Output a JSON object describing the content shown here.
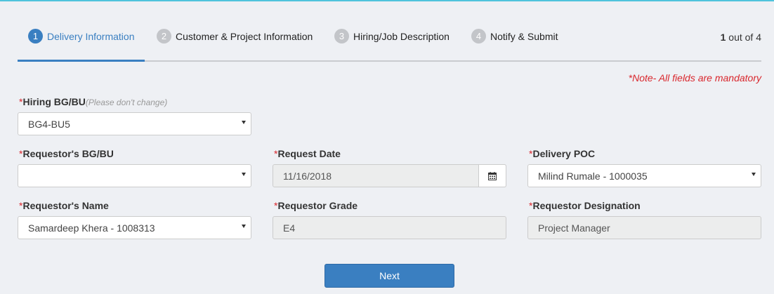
{
  "steps": [
    {
      "num": "1",
      "label": "Delivery Information",
      "active": true
    },
    {
      "num": "2",
      "label": "Customer & Project Information",
      "active": false
    },
    {
      "num": "3",
      "label": "Hiring/Job Description",
      "active": false
    },
    {
      "num": "4",
      "label": "Notify & Submit",
      "active": false
    }
  ],
  "progress": {
    "current": "1",
    "suffix": "out of 4"
  },
  "note": "*Note- All fields are mandatory",
  "required_marker": "*",
  "fields": {
    "hiring_bgbu": {
      "label": "Hiring BG/BU",
      "hint": "(Please don't change)",
      "value": "BG4-BU5"
    },
    "requestor_bgbu": {
      "label": "Requestor's BG/BU",
      "value": ""
    },
    "request_date": {
      "label": "Request Date",
      "value": "11/16/2018"
    },
    "delivery_poc": {
      "label": "Delivery POC",
      "value": "Milind Rumale - 1000035"
    },
    "requestor_name": {
      "label": "Requestor's Name",
      "value": "Samardeep Khera - 1008313"
    },
    "requestor_grade": {
      "label": "Requestor Grade",
      "value": "E4"
    },
    "requestor_designation": {
      "label": "Requestor Designation",
      "value": "Project Manager"
    }
  },
  "actions": {
    "next_label": "Next"
  },
  "icons": {
    "calendar": "calendar-icon",
    "dropdown": "caret-down-icon"
  },
  "colors": {
    "accent": "#3a7fc1",
    "required": "#d9262c",
    "top_line": "#4fc3dc"
  }
}
